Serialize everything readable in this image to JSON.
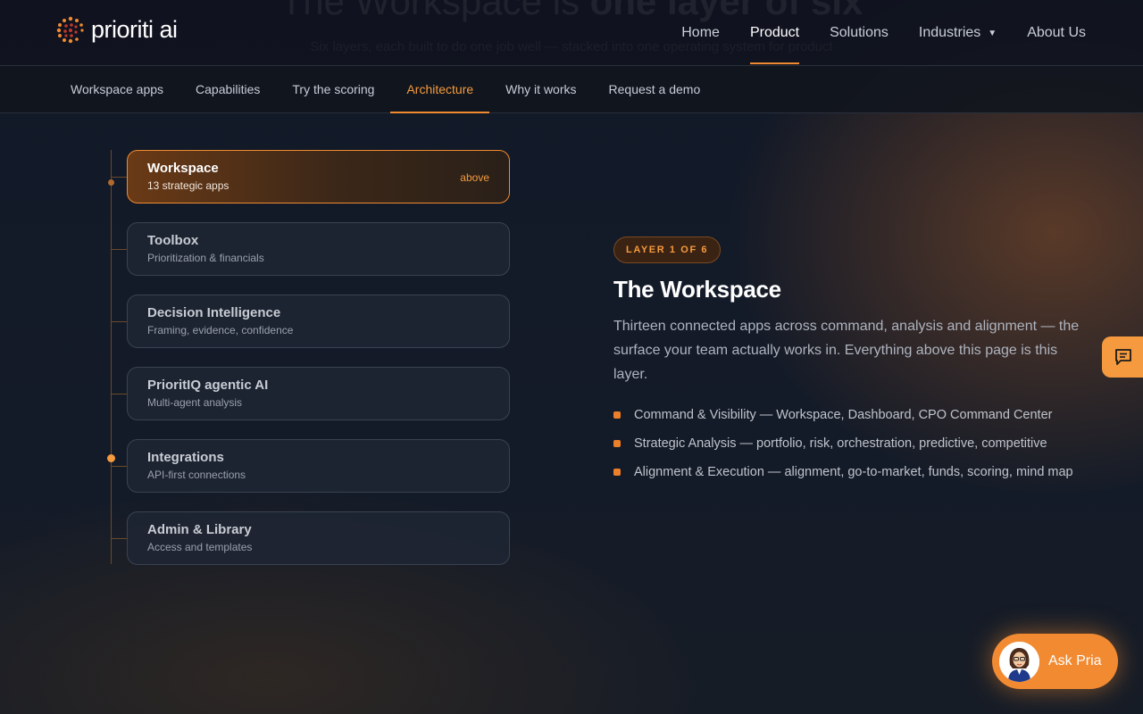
{
  "brand": {
    "name": "prioriti ai"
  },
  "colors": {
    "accent": "#f08a30",
    "bg": "#0f1521"
  },
  "backdrop": {
    "title_light": "The Workspace is ",
    "title_bold": "one layer of six",
    "subtitle": "Six layers, each built to do one job well — stacked into one operating system for product"
  },
  "nav": {
    "items": [
      {
        "label": "Home",
        "active": false
      },
      {
        "label": "Product",
        "active": true
      },
      {
        "label": "Solutions",
        "active": false
      },
      {
        "label": "Industries",
        "active": false,
        "dropdown": true
      },
      {
        "label": "About Us",
        "active": false
      }
    ]
  },
  "subnav": {
    "items": [
      {
        "label": "Workspace apps"
      },
      {
        "label": "Capabilities"
      },
      {
        "label": "Try the scoring"
      },
      {
        "label": "Architecture",
        "active": true
      },
      {
        "label": "Why it works"
      },
      {
        "label": "Request a demo"
      }
    ]
  },
  "layers": [
    {
      "name": "Workspace",
      "desc": "13 strategic apps",
      "tag": "above",
      "active": true
    },
    {
      "name": "Toolbox",
      "desc": "Prioritization & financials"
    },
    {
      "name": "Decision Intelligence",
      "desc": "Framing, evidence, confidence"
    },
    {
      "name": "PrioritIQ agentic AI",
      "desc": "Multi-agent analysis"
    },
    {
      "name": "Integrations",
      "desc": "API-first connections"
    },
    {
      "name": "Admin & Library",
      "desc": "Access and templates"
    }
  ],
  "detail": {
    "badge": "LAYER 1 OF 6",
    "title": "The Workspace",
    "lede": "Thirteen connected apps across command, analysis and alignment — the surface your team actually works in. Everything above this page is this layer.",
    "bullets": [
      "Command & Visibility — Workspace, Dashboard, CPO Command Center",
      "Strategic Analysis — portfolio, risk, orchestration, predictive, competitive",
      "Alignment & Execution — alignment, go-to-market, funds, scoring, mind map"
    ]
  },
  "assistant": {
    "label": "Ask Pria",
    "icon": "chat-bubble-icon"
  }
}
